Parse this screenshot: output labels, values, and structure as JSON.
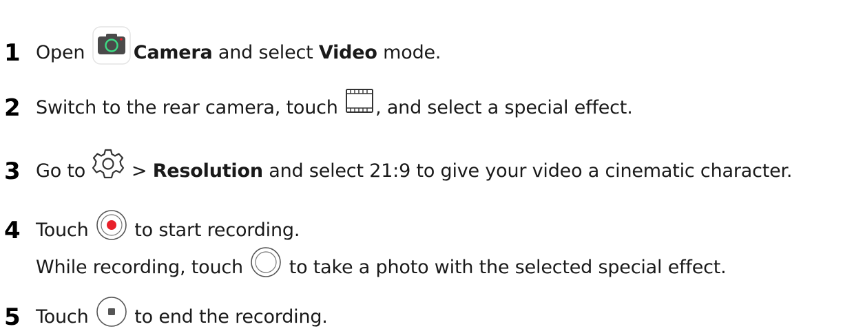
{
  "steps": [
    {
      "number": "1",
      "pre": "Open ",
      "bold1": "Camera",
      "mid": " and select ",
      "bold2": "Video",
      "post": " mode."
    },
    {
      "number": "2",
      "pre": "Switch to the rear camera, touch ",
      "post": ", and select a special effect."
    },
    {
      "number": "3",
      "pre": "Go to ",
      "mid": " > ",
      "bold1": "Resolution",
      "post": " and select 21:9 to give your video a cinematic character."
    },
    {
      "number": "4",
      "pre": "Touch ",
      "post": " to start recording.",
      "sub_pre": "While recording, touch ",
      "sub_post": " to take a photo with the selected special effect."
    },
    {
      "number": "5",
      "pre": "Touch ",
      "post": " to end the recording."
    }
  ],
  "icons": {
    "camera": "camera-app-icon",
    "filter": "filter-effect-icon",
    "settings": "gear-icon",
    "record": "record-button-icon",
    "shutter": "shutter-button-icon",
    "stop": "stop-button-icon"
  },
  "colors": {
    "record_red": "#e8202a",
    "camera_green": "#3ddc84",
    "camera_body": "#4a4a4a"
  }
}
